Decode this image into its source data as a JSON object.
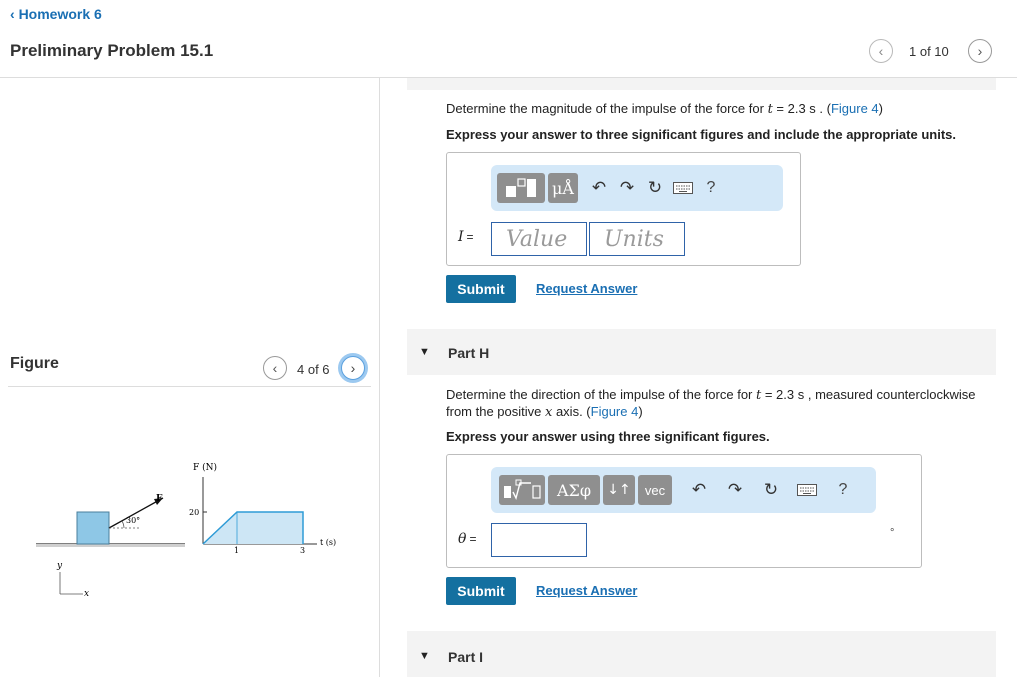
{
  "header": {
    "back_label": "Homework 6",
    "title": "Preliminary Problem 15.1",
    "pager": {
      "prev_icon": "‹",
      "text": "1 of 10",
      "next_icon": "›"
    }
  },
  "figure": {
    "heading": "Figure",
    "pager": {
      "prev_icon": "‹",
      "text": "4 of 6",
      "next_icon": "›"
    },
    "diagram": {
      "force_label": "F",
      "angle_label": "30°",
      "y_axis": "y",
      "x_axis": "x",
      "graph_ylabel": "F (N)",
      "graph_xlabel": "t (s)",
      "y_tick": "20",
      "x_tick_1": "1",
      "x_tick_3": "3"
    }
  },
  "part_g": {
    "prompt_pre": "Determine the magnitude of the impulse of the force for ",
    "prompt_var": "t",
    "prompt_value": " = 2.3  s . (",
    "figure_link": "Figure 4",
    "prompt_post": ")",
    "instruction": "Express your answer to three significant figures and include the appropriate units.",
    "toolbar": {
      "units_btn": "μÅ",
      "help": "?"
    },
    "variable": "I",
    "equals": "=",
    "value_placeholder": "Value",
    "units_placeholder": "Units",
    "submit": "Submit",
    "request": "Request Answer"
  },
  "part_h": {
    "title": "Part H",
    "prompt_pre": "Determine the direction of the impulse of the force for ",
    "prompt_var": "t",
    "prompt_value": " = 2.3  s , measured counterclockwise",
    "prompt_line2_pre": "from the positive ",
    "prompt_axis": "x",
    "prompt_line2_post": " axis. (",
    "figure_link": "Figure 4",
    "prompt_post": ")",
    "instruction": "Express your answer using three significant figures.",
    "toolbar": {
      "greek_btn": "ΑΣφ",
      "arrows_btn": "↓↑",
      "vec_btn": "vec",
      "help": "?"
    },
    "variable": "θ",
    "equals": "=",
    "unit_symbol": "°",
    "submit": "Submit",
    "request": "Request Answer"
  },
  "part_i": {
    "title": "Part I"
  }
}
